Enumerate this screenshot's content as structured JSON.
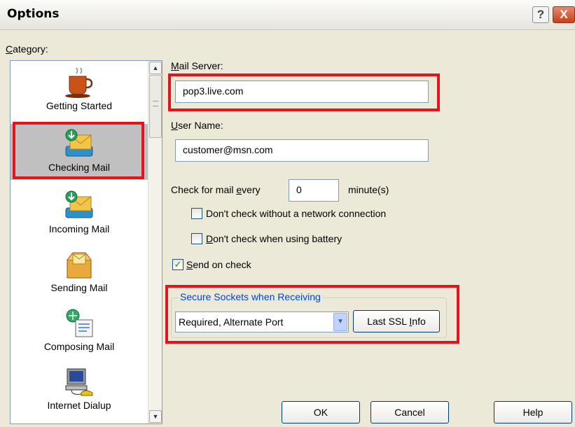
{
  "window": {
    "title": "Options",
    "help_glyph": "?",
    "close_glyph": "X"
  },
  "category": {
    "label_accel": "C",
    "label_rest": "ategory:",
    "items": [
      {
        "label": "Getting Started",
        "icon": "coffee-cup-icon"
      },
      {
        "label": "Checking Mail",
        "icon": "checking-mail-icon",
        "selected": true
      },
      {
        "label": "Incoming Mail",
        "icon": "incoming-mail-icon"
      },
      {
        "label": "Sending Mail",
        "icon": "sending-mail-icon"
      },
      {
        "label": "Composing Mail",
        "icon": "composing-mail-icon"
      },
      {
        "label": "Internet Dialup",
        "icon": "internet-dialup-icon"
      }
    ]
  },
  "mail_server": {
    "label_accel": "M",
    "label_rest": "ail Server:",
    "value": "pop3.live.com"
  },
  "user_name": {
    "label_accel": "U",
    "label_rest": "ser Name:",
    "value": "customer@msn.com"
  },
  "check_interval": {
    "label_before": "Check for mail ",
    "label_accel": "e",
    "label_after": "very",
    "value": "0",
    "unit": "minute(s)"
  },
  "options": {
    "no_network": {
      "accel": "",
      "label": "Don't check without a network connection",
      "checked": false
    },
    "battery": {
      "accel": "D",
      "label": "on't check when using battery",
      "checked": false
    },
    "send_on_check": {
      "accel": "S",
      "label": "end on check",
      "checked": true
    }
  },
  "ssl": {
    "group_title": "Secure Sockets when Receiving",
    "selected_option": "Required, Alternate Port",
    "info_button_before": "Last SSL ",
    "info_button_accel": "I",
    "info_button_after": "nfo"
  },
  "buttons": {
    "ok": "OK",
    "cancel": "Cancel",
    "help": "Help"
  },
  "check_glyph": "✓",
  "scroll_up_glyph": "▲",
  "scroll_down_glyph": "▼",
  "dropdown_glyph": "▼"
}
